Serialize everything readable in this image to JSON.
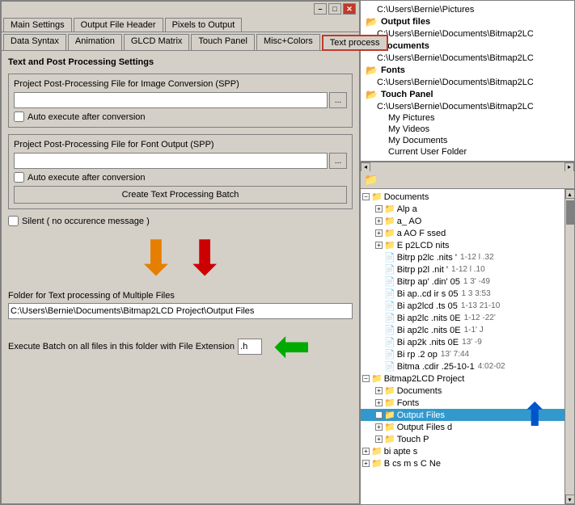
{
  "window": {
    "min_label": "–",
    "max_label": "□",
    "close_label": "✕"
  },
  "tabs_row1": {
    "items": [
      {
        "label": "Main Settings",
        "active": false
      },
      {
        "label": "Output File Header",
        "active": false
      },
      {
        "label": "Pixels to Output",
        "active": false
      }
    ]
  },
  "tabs_row2": {
    "items": [
      {
        "label": "Data Syntax",
        "active": false
      },
      {
        "label": "Animation",
        "active": false
      },
      {
        "label": "GLCD Matrix",
        "active": false
      },
      {
        "label": "Touch Panel",
        "active": false
      },
      {
        "label": "Misc+Colors",
        "active": false
      },
      {
        "label": "Text process",
        "active": true
      }
    ]
  },
  "content": {
    "section_title": "Text and Post Processing Settings",
    "spp_image_label": "Project Post-Processing File for Image Conversion (SPP)",
    "spp_image_value": "",
    "spp_image_auto": "Auto execute after conversion",
    "spp_font_label": "Project Post-Processing File for Font Output (SPP)",
    "spp_font_value": "",
    "spp_font_auto": "Auto execute after conversion",
    "create_batch_btn": "Create Text Processing Batch",
    "silent_label": "Silent ( no occurence message )",
    "folder_label": "Folder for Text processing of Multiple Files",
    "folder_value": "C:\\Users\\Bernie\\Documents\\Bitmap2LCD Project\\Output Files",
    "execute_label": "Execute Batch on all files in this folder with File Extension",
    "ext_value": ".h"
  },
  "right_panel": {
    "paths": [
      {
        "text": "C:\\Users\\Bernie\\Pictures",
        "indent": 0
      },
      {
        "text": "Output files",
        "indent": 0,
        "bold": true
      },
      {
        "text": "C:\\Users\\Bernie\\Documents\\Bitmap2LCD",
        "indent": 1
      },
      {
        "text": "Documents",
        "indent": 0,
        "bold": true
      },
      {
        "text": "C:\\Users\\Bernie\\Documents\\Bitmap2LCD",
        "indent": 1
      },
      {
        "text": "Fonts",
        "indent": 0,
        "bold": true
      },
      {
        "text": "C:\\Users\\Bernie\\Documents\\Bitmap2LCD",
        "indent": 1
      },
      {
        "text": "Touch Panel",
        "indent": 0,
        "bold": true
      },
      {
        "text": "C:\\Users\\Bernie\\Documents\\Bitmap2LCD",
        "indent": 1
      },
      {
        "text": "My Pictures",
        "indent": 1
      },
      {
        "text": "My Videos",
        "indent": 1
      },
      {
        "text": "My Documents",
        "indent": 1
      },
      {
        "text": "Current User Folder",
        "indent": 1
      }
    ],
    "tree_items": [
      {
        "label": "Documents",
        "level": 0,
        "expanded": true,
        "is_folder": true
      },
      {
        "label": "Alp a",
        "level": 1,
        "expanded": false,
        "is_folder": true
      },
      {
        "label": "a_ AO",
        "level": 1,
        "expanded": false,
        "is_folder": true
      },
      {
        "label": "a AO F ssed",
        "level": 1,
        "expanded": false,
        "is_folder": true
      },
      {
        "label": "E p2LCD nits",
        "level": 1,
        "expanded": false,
        "is_folder": true
      },
      {
        "label": "Bitrp p2lc .nits '",
        "level": 1,
        "meta": "1-12 l .32",
        "is_folder": false
      },
      {
        "label": "Bitrp p2l .nit '",
        "level": 1,
        "meta": "1-12 l .10",
        "is_folder": false
      },
      {
        "label": "Bitrp ap' .din' 05",
        "level": 1,
        "meta": "1 3' -49",
        "is_folder": false
      },
      {
        "label": "Bi ap..cd ir s 05",
        "level": 1,
        "meta": "1 3 3:53",
        "is_folder": false
      },
      {
        "label": "Bi ap2lcd .ts 05",
        "level": 1,
        "meta": "1-13 21-10",
        "is_folder": false
      },
      {
        "label": "Bi ap2lc .nits 0E",
        "level": 1,
        "meta": "1-12 -22'",
        "is_folder": false
      },
      {
        "label": "Bi ap2lc .nits 0E",
        "level": 1,
        "meta": "1-1' J",
        "is_folder": false
      },
      {
        "label": "Bi ap2k .nits 0E",
        "level": 1,
        "meta": "13' -9",
        "is_folder": false
      },
      {
        "label": "Bi rp .2 op",
        "level": 1,
        "meta": "13' 7:44",
        "is_folder": false
      },
      {
        "label": "Bitma .cdir .25-10-1",
        "level": 1,
        "meta": "4:02-02",
        "is_folder": false
      },
      {
        "label": "Bitmap2LCD Project",
        "level": 0,
        "expanded": true,
        "is_folder": true
      },
      {
        "label": "Documents",
        "level": 1,
        "expanded": false,
        "is_folder": true
      },
      {
        "label": "Fonts",
        "level": 1,
        "expanded": false,
        "is_folder": true
      },
      {
        "label": "Output Files",
        "level": 1,
        "expanded": false,
        "is_folder": true,
        "selected": true
      },
      {
        "label": "Output Files d",
        "level": 1,
        "expanded": false,
        "is_folder": true
      },
      {
        "label": "Touch P",
        "level": 1,
        "expanded": false,
        "is_folder": true
      },
      {
        "label": "bi apte s",
        "level": 0,
        "expanded": false,
        "is_folder": true
      },
      {
        "label": "B cs m s C Ne",
        "level": 0,
        "expanded": false,
        "is_folder": true
      }
    ]
  }
}
